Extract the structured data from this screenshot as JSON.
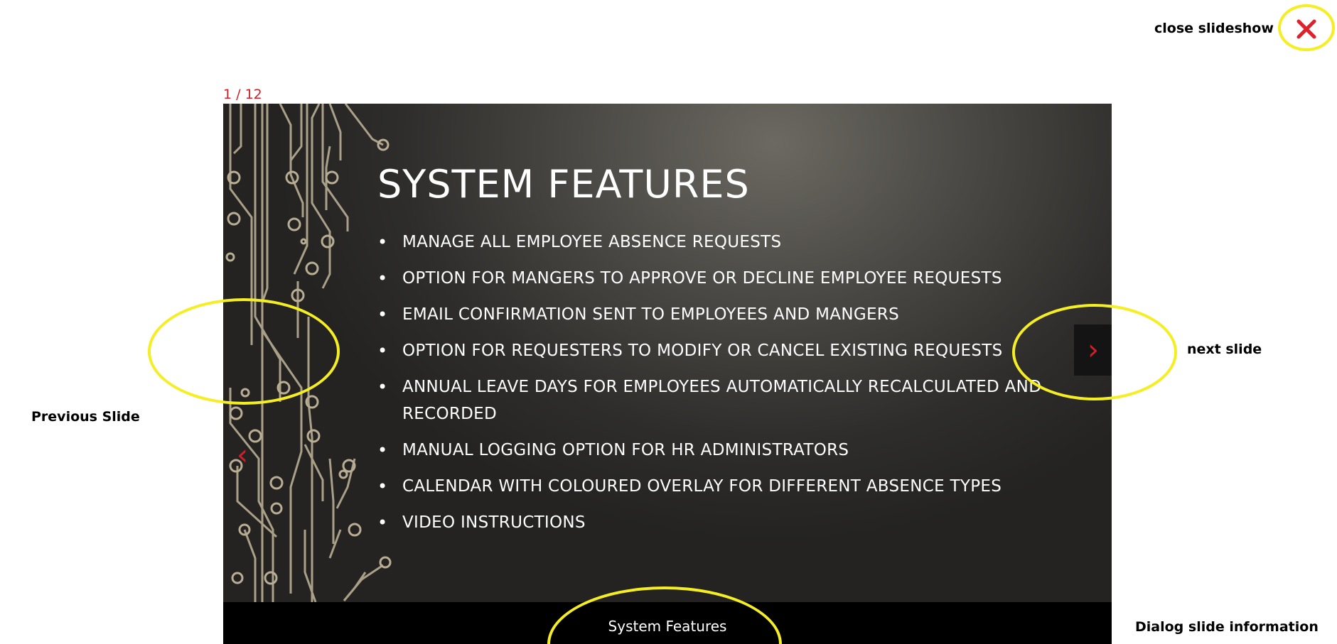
{
  "slideshow": {
    "counter": "1 / 12",
    "slide": {
      "title": "SYSTEM FEATURES",
      "bullets": [
        "MANAGE ALL EMPLOYEE ABSENCE REQUESTS",
        "OPTION FOR MANGERS TO APPROVE OR DECLINE EMPLOYEE REQUESTS",
        "EMAIL CONFIRMATION SENT TO EMPLOYEES AND MANGERS",
        "OPTION FOR REQUESTERS TO MODIFY OR CANCEL EXISTING REQUESTS",
        "ANNUAL LEAVE DAYS FOR EMPLOYEES AUTOMATICALLY RECALCULATED AND RECORDED",
        "MANUAL LOGGING OPTION FOR HR ADMINISTRATORS",
        "CALENDAR WITH COLOURED OVERLAY FOR DIFFERENT ABSENCE TYPES",
        "VIDEO INSTRUCTIONS"
      ]
    },
    "caption": "System Features",
    "prev_glyph": "‹",
    "next_glyph": "›",
    "close_icon": "close-icon"
  },
  "annotations": {
    "close": "close slideshow",
    "previous": "Previous Slide",
    "next": "next slide",
    "caption": "Dialog slide information"
  },
  "colors": {
    "accent": "#d0202a",
    "highlight": "#f5ee22",
    "caption_bar": "#000000"
  }
}
